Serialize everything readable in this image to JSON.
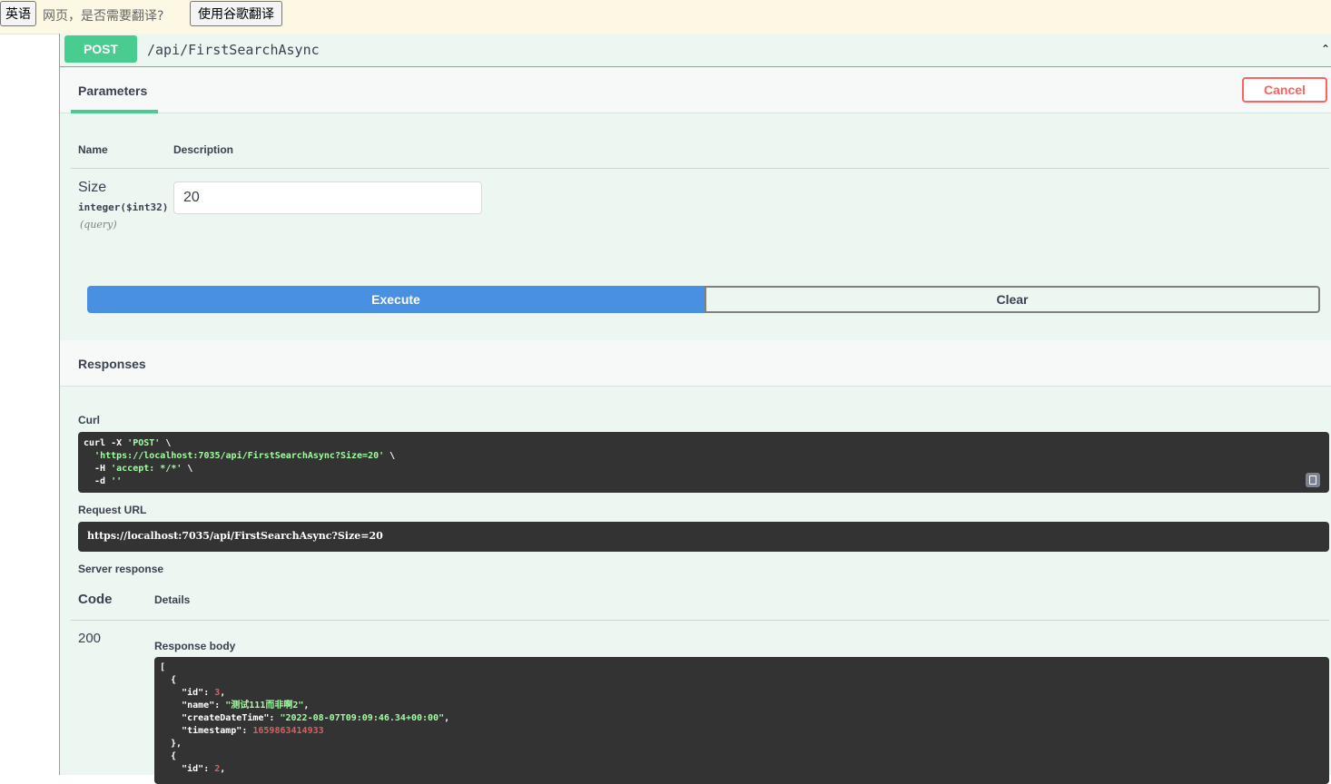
{
  "translate_bar": {
    "lang_button": "英语",
    "prompt": "网页，是否需要翻译?",
    "use_button": "使用谷歌翻译"
  },
  "operation": {
    "method": "POST",
    "path": "/api/FirstSearchAsync",
    "collapse_icon": "chevron-up-icon"
  },
  "parameters": {
    "tab_label": "Parameters",
    "cancel_label": "Cancel",
    "columns": {
      "name": "Name",
      "description": "Description"
    },
    "items": [
      {
        "name": "Size",
        "type": "integer($int32)",
        "in": "(query)",
        "value": "20"
      }
    ]
  },
  "actions": {
    "execute_label": "Execute",
    "clear_label": "Clear"
  },
  "responses": {
    "title": "Responses",
    "curl_label": "Curl",
    "curl_lines": [
      [
        "curl -X ",
        "'POST'",
        " \\"
      ],
      [
        "  ",
        "'https://localhost:7035/api/FirstSearchAsync?Size=20'",
        " \\"
      ],
      [
        "  -H ",
        "'accept: */*'",
        " \\"
      ],
      [
        "  -d ",
        "''",
        ""
      ]
    ],
    "request_url_label": "Request URL",
    "request_url": "https://localhost:7035/api/FirstSearchAsync?Size=20",
    "server_response_label": "Server response",
    "code_header": "Code",
    "details_header": "Details",
    "status_code": "200",
    "response_body_label": "Response body",
    "body": {
      "open_bracket": "[",
      "obj_open": "  {",
      "id_key": "\"id\"",
      "id_value": "3",
      "name_key": "\"name\"",
      "name_value": "\"测试111而非啊2\"",
      "create_key": "\"createDateTime\"",
      "create_value": "\"2022-08-07T09:09:46.34+00:00\"",
      "ts_key": "\"timestamp\"",
      "ts_value": "1659863414933",
      "obj_close": "  },",
      "obj2_open": "  {",
      "id2_value": "2"
    }
  },
  "colors": {
    "post_green": "#49cc90",
    "execute_blue": "#4990e2",
    "cancel_red": "#ff6060",
    "code_bg": "#333333"
  }
}
